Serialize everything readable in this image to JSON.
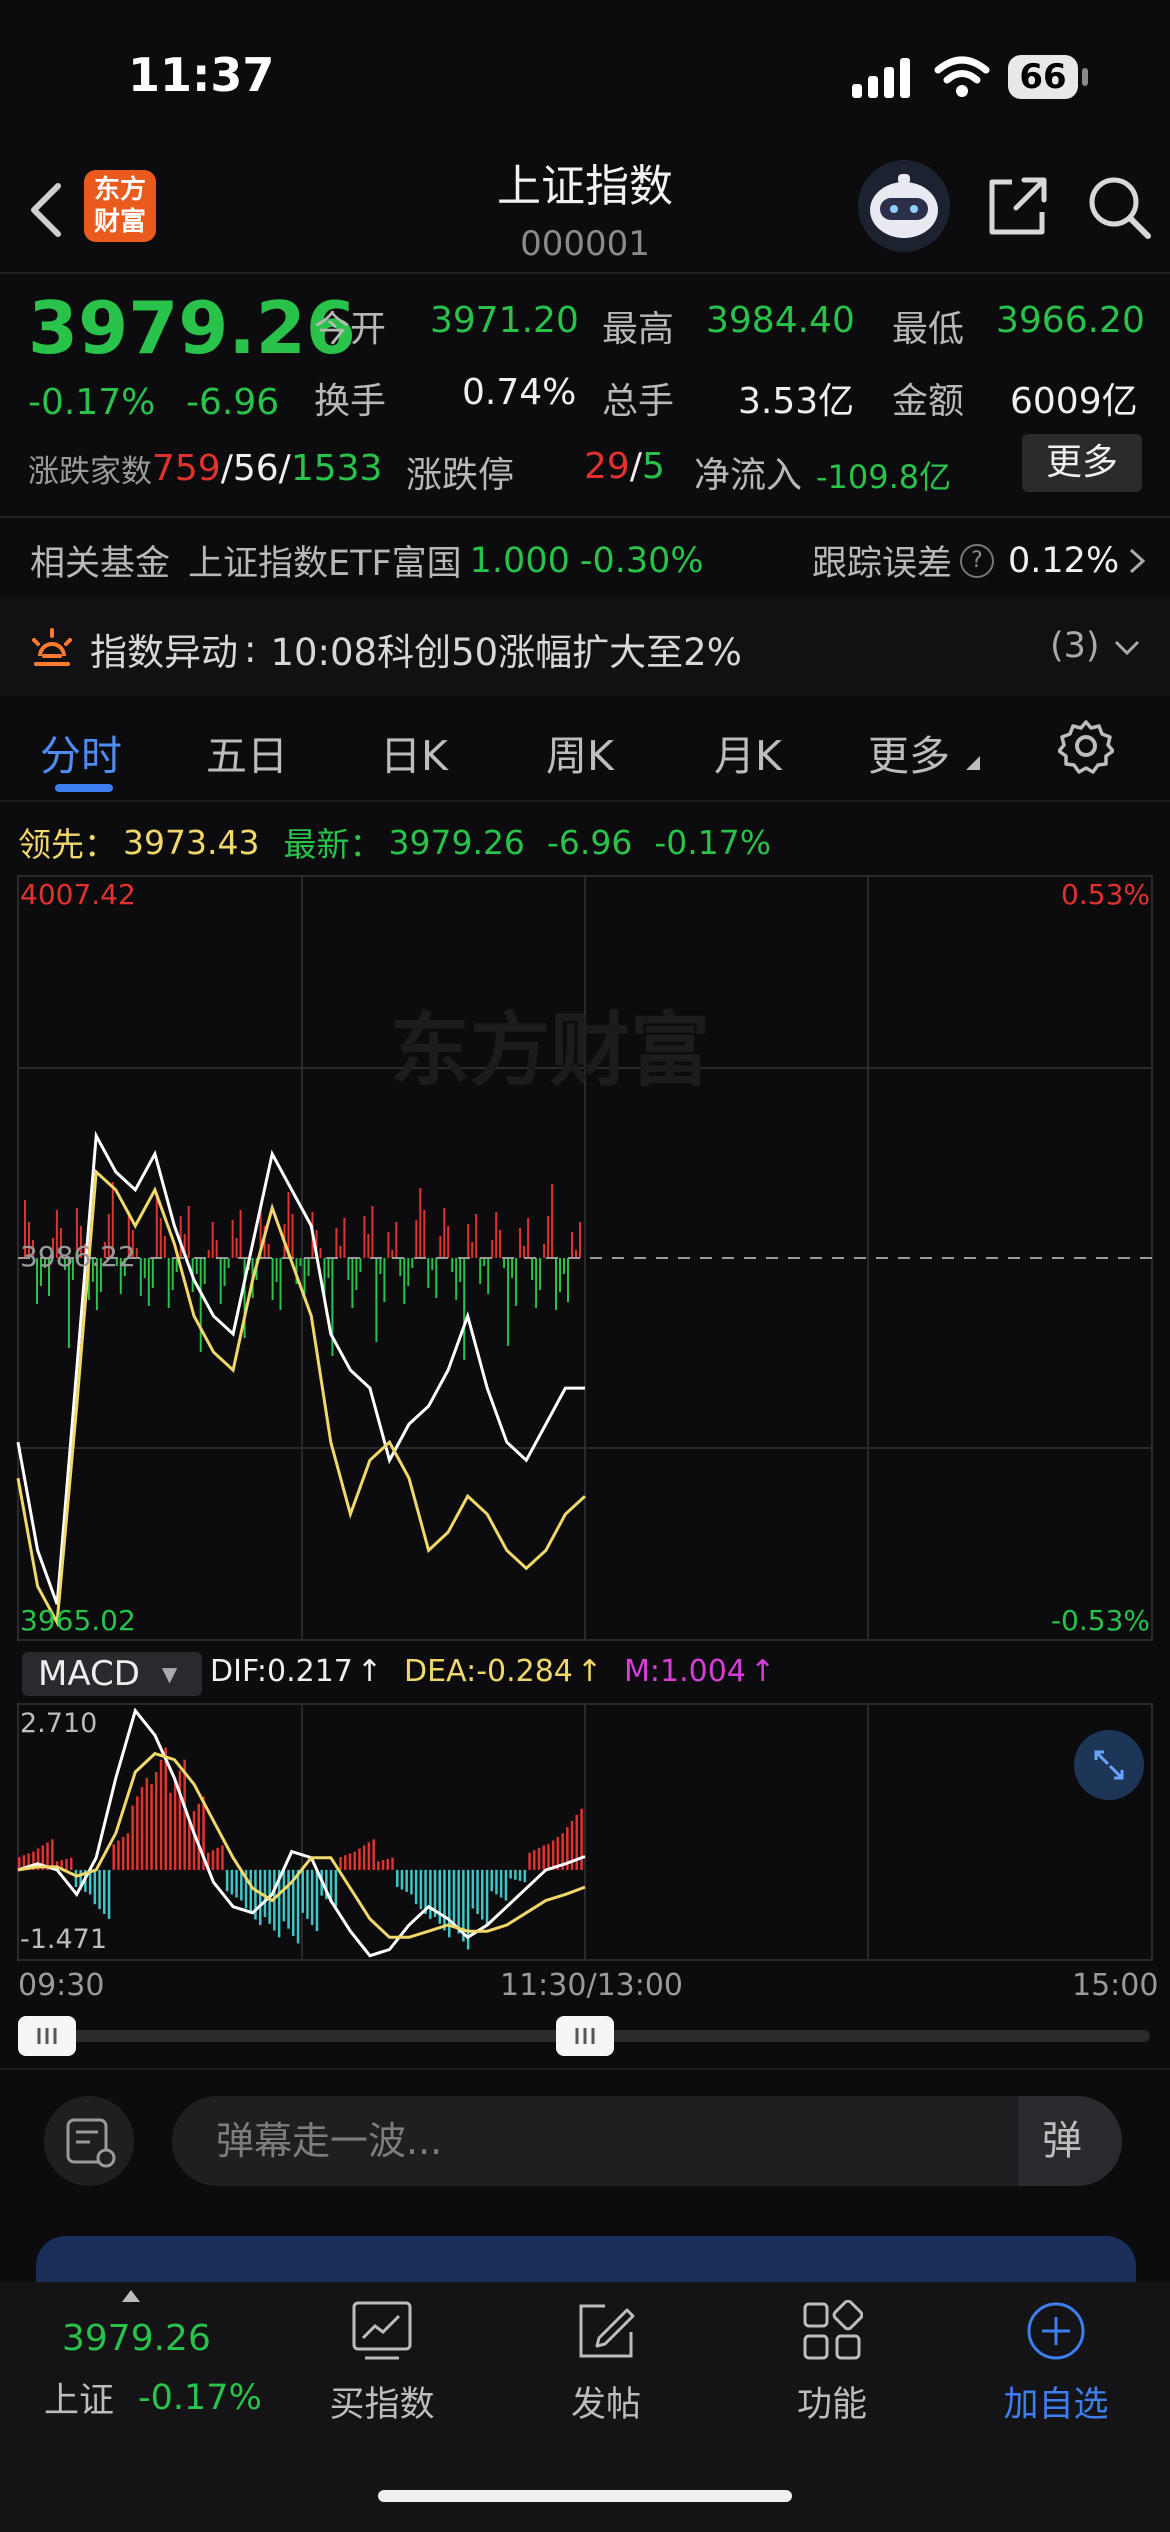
{
  "status_bar": {
    "time": "11:37",
    "battery": "66"
  },
  "header": {
    "logo_text": "东方财富",
    "title": "上证指数",
    "code": "000001"
  },
  "quote": {
    "price": "3979.26",
    "change_pct": "-0.17%",
    "change": "-6.96",
    "open_label": "今开",
    "open": "3971.20",
    "high_label": "最高",
    "high": "3984.40",
    "low_label": "最低",
    "low": "3966.20",
    "turnover_label": "换手",
    "turnover": "0.74%",
    "volume_label": "总手",
    "volume": "3.53亿",
    "amount_label": "金额",
    "amount": "6009亿",
    "breadth_label": "涨跌家数",
    "up": "759",
    "flat": "56",
    "down": "1533",
    "limit_label": "涨跌停",
    "limit_up": "29",
    "limit_down": "5",
    "netflow_label": "净流入",
    "netflow": "-109.8亿",
    "more_button": "更多"
  },
  "fund": {
    "label": "相关基金",
    "name": "上证指数ETF富国",
    "price": "1.000",
    "pct": "-0.30%",
    "tracking_label": "跟踪误差",
    "tracking": "0.12%"
  },
  "alert": {
    "label": "指数异动",
    "text": "10:08科创50涨幅扩大至2%",
    "count": "(3)"
  },
  "tabs": [
    "分时",
    "五日",
    "日K",
    "周K",
    "月K",
    "更多"
  ],
  "indicators": {
    "leader_label": "领先：",
    "leader": "3973.43",
    "latest_label": "最新：",
    "latest": "3979.26",
    "change": "-6.96",
    "pct": "-0.17%"
  },
  "chart_data": {
    "type": "line",
    "title": "",
    "y_max": "4007.42",
    "y_mid": "3986.22",
    "y_min": "3965.02",
    "pct_max": "0.53%",
    "pct_min": "-0.53%",
    "x_labels": [
      "09:30",
      "11:30/13:00",
      "15:00"
    ],
    "watermark": "东方财富",
    "ylim": [
      3965.02,
      4007.42
    ],
    "series": [
      {
        "name": "最新",
        "color": "#ffffff",
        "values": [
          3976,
          3970,
          3967,
          3980,
          3993,
          3991,
          3990,
          3992,
          3988,
          3985,
          3983,
          3982,
          3987,
          3992,
          3990,
          3988,
          3982,
          3980,
          3979,
          3975,
          3977,
          3978,
          3980,
          3983,
          3979,
          3976,
          3975,
          3977,
          3979,
          3979
        ]
      },
      {
        "name": "领先",
        "color": "#f1d86a",
        "values": [
          3974,
          3968,
          3966,
          3978,
          3991,
          3990,
          3988,
          3990,
          3987,
          3983,
          3981,
          3980,
          3985,
          3989,
          3986,
          3983,
          3976,
          3972,
          3975,
          3976,
          3974,
          3970,
          3971,
          3973,
          3972,
          3970,
          3969,
          3970,
          3972,
          3973
        ]
      }
    ],
    "macd": {
      "label": "MACD",
      "dif_label": "DIF:",
      "dif": "0.217",
      "dea_label": "DEA:",
      "dea": "-0.284",
      "m_label": "M:",
      "m": "1.004",
      "y_max": "2.710",
      "y_min": "-1.471",
      "ylim": [
        -1.471,
        2.71
      ],
      "bars": [
        0.3,
        0.5,
        0.2,
        -0.4,
        -0.8,
        0.6,
        1.5,
        2.0,
        1.8,
        1.2,
        0.4,
        -0.5,
        -0.9,
        -1.1,
        -1.2,
        -1.0,
        -0.6,
        0.3,
        0.5,
        0.2,
        -0.4,
        -0.8,
        -1.1,
        -1.3,
        -0.9,
        -0.5,
        -0.2,
        0.4,
        0.6,
        1.0
      ],
      "dif_values": [
        0.0,
        0.1,
        0.0,
        -0.4,
        0.2,
        1.5,
        2.6,
        2.2,
        1.5,
        0.6,
        -0.2,
        -0.6,
        -0.7,
        -0.4,
        0.3,
        0.2,
        -0.5,
        -1.0,
        -1.4,
        -1.3,
        -0.9,
        -0.6,
        -0.8,
        -1.1,
        -0.9,
        -0.6,
        -0.3,
        0.0,
        0.1,
        0.22
      ],
      "dea_values": [
        0.0,
        0.05,
        0.05,
        -0.1,
        0.0,
        0.6,
        1.6,
        1.9,
        1.8,
        1.4,
        0.8,
        0.2,
        -0.3,
        -0.5,
        -0.2,
        0.2,
        0.2,
        -0.3,
        -0.8,
        -1.1,
        -1.1,
        -1.0,
        -0.9,
        -1.0,
        -1.0,
        -0.9,
        -0.7,
        -0.5,
        -0.4,
        -0.28
      ]
    }
  },
  "danmaku": {
    "placeholder": "弹幕走一波..."
  },
  "bottom_nav": {
    "index_price": "3979.26",
    "index_name": "上证",
    "index_pct": "-0.17%",
    "items": [
      "买指数",
      "发帖",
      "功能",
      "加自选"
    ]
  },
  "colors": {
    "up": "#e2322f",
    "down": "#29c24a",
    "accent": "#3d7ef0"
  }
}
